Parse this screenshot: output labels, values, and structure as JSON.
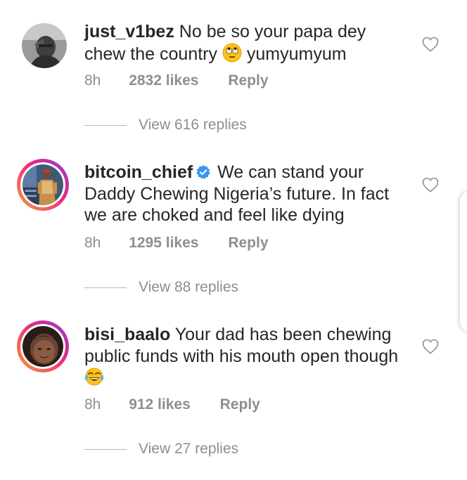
{
  "comments": [
    {
      "username": "just_v1bez",
      "text": "No be so your papa dey chew the country",
      "text_after_emoji": "yumyumyum",
      "emoji": "face-with-rolling-eyes",
      "verified": false,
      "time": "8h",
      "likes": "2832 likes",
      "reply": "Reply",
      "view_replies": "View 616 replies"
    },
    {
      "username": "bitcoin_chief",
      "text": "We can stand your Daddy Chewing Nigeria’s future. In fact we are choked and feel like dying",
      "verified": true,
      "time": "8h",
      "likes": "1295 likes",
      "reply": "Reply",
      "view_replies": "View 88 replies"
    },
    {
      "username": "bisi_baalo",
      "text": "Your dad has been chewing public funds with his mouth open though",
      "emoji": "face-with-tears-of-joy",
      "verified": false,
      "time": "8h",
      "likes": "912 likes",
      "reply": "Reply",
      "view_replies": "View 27 replies"
    }
  ],
  "colors": {
    "text": "#262626",
    "secondary": "#8e8e8e",
    "verified": "#3897f0",
    "story_ring_start": "#f9a13a",
    "story_ring_end": "#8f3bd6"
  },
  "icons": [
    "heart-outline-icon",
    "verified-badge-icon"
  ]
}
